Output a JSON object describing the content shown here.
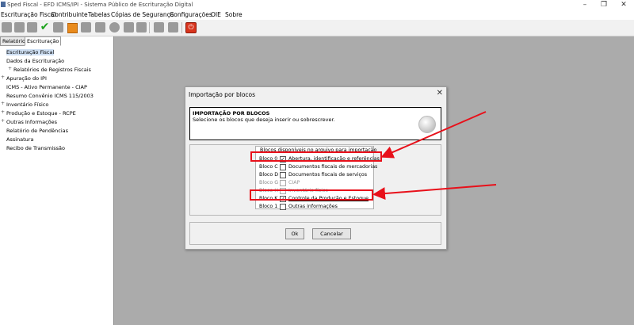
{
  "window": {
    "title": "Sped Fiscal - EFD ICMS/IPI - Sistema Público de Escrituração Digital"
  },
  "menu": [
    "Escrituração Fiscal",
    "Contribuinte",
    "Tabelas",
    "Cópias de Segurança",
    "Configurações",
    "OIE",
    "Sobre"
  ],
  "toolbar": {
    "icons": [
      "doc-icon",
      "doc-icon",
      "doc-icon",
      "check-icon",
      "doc-icon",
      "stop-icon",
      "gear-icon",
      "gear-icon",
      "db-icon",
      "envelope-icon",
      "db-icon",
      "grid-icon",
      "grid-icon",
      "power-icon"
    ]
  },
  "left": {
    "tabs": [
      "Relatórios",
      "Escrituração"
    ],
    "tree": [
      "Escrituração Fiscal",
      "Dados da Escrituração",
      "Relatórios de Registros Fiscais",
      "Apuração do IPI",
      "ICMS - Ativo Permanente - CIAP",
      "Resumo Convênio ICMS 115/2003",
      "Inventário Físico",
      "Produção e Estoque - RCPE",
      "Outras Informações",
      "Relatório de Pendências",
      "Assinatura",
      "Recibo de Transmissão"
    ]
  },
  "dialog": {
    "title": "Importação por blocos",
    "header_title": "IMPORTAÇÃO POR BLOCOS",
    "header_subtitle": "Selecione os blocos que deseja inserir ou sobrescrever.",
    "blocks_header": "Blocos disponíveis no arquivo para importação",
    "blocks": [
      {
        "code": "Bloco 0",
        "desc": "Abertura, identificação e referências",
        "checked": true,
        "enabled": true
      },
      {
        "code": "Bloco C",
        "desc": "Documentos fiscais de mercadorias",
        "checked": false,
        "enabled": true
      },
      {
        "code": "Bloco D",
        "desc": "Documentos fiscais de serviços",
        "checked": false,
        "enabled": true
      },
      {
        "code": "Bloco G",
        "desc": "CIAP",
        "checked": false,
        "enabled": false
      },
      {
        "code": "Bloco H",
        "desc": "Inventário físico",
        "checked": false,
        "enabled": false
      },
      {
        "code": "Bloco K",
        "desc": "Controle da Produção e Estoque",
        "checked": true,
        "enabled": true
      },
      {
        "code": "Bloco 1",
        "desc": "Outras informações",
        "checked": false,
        "enabled": true
      }
    ],
    "ok_label": "Ok",
    "cancel_label": "Cancelar"
  },
  "colors": {
    "annotation": "#e8101a",
    "workspace": "#ababab",
    "check": "#1fa31f"
  }
}
